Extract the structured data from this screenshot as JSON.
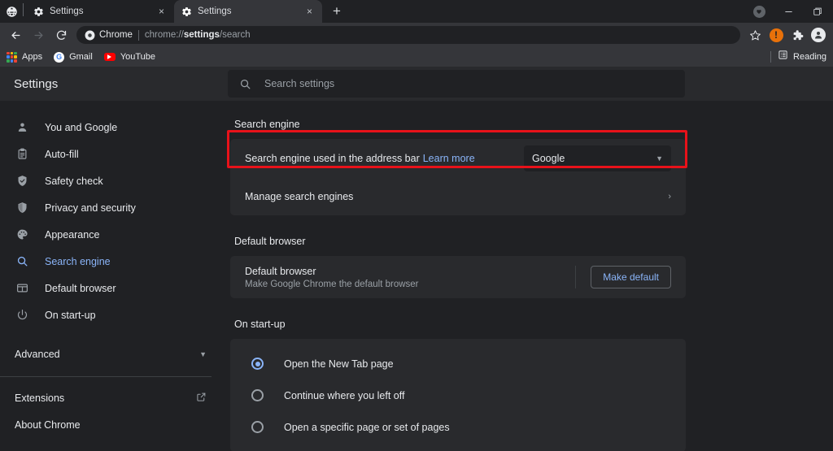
{
  "window": {
    "brand_icon": "globe-icon",
    "controls": [
      {
        "name": "window-pill-icon",
        "glyph": "♥"
      },
      {
        "name": "minimize-icon",
        "glyph": "—"
      },
      {
        "name": "maximize-icon",
        "glyph": "❐"
      }
    ]
  },
  "tabs": [
    {
      "title": "Settings",
      "favicon": "gear-icon",
      "close": "×",
      "active": false
    },
    {
      "title": "Settings",
      "favicon": "gear-icon",
      "close": "×",
      "active": true
    }
  ],
  "new_tab_label": "+",
  "toolbar": {
    "back": "←",
    "forward": "→",
    "reload": "↻",
    "omnibox": {
      "chip_label": "Chrome",
      "url_prefix": "chrome://",
      "url_bold": "settings",
      "url_suffix": "/search"
    },
    "bookmark_star": "☆",
    "alert_badge": "!",
    "extensions_icon": "puzzle-icon",
    "profile_icon": "avatar-icon"
  },
  "bookmarks": {
    "items": [
      {
        "label": "Apps",
        "icon": "apps-grid-icon"
      },
      {
        "label": "Gmail",
        "icon": "gmail-icon"
      },
      {
        "label": "YouTube",
        "icon": "youtube-icon"
      }
    ],
    "reading_list": "Reading"
  },
  "settings": {
    "title": "Settings",
    "search": {
      "placeholder": "Search settings",
      "value": ""
    },
    "sidebar": {
      "items": [
        {
          "label": "You and Google",
          "icon": "person-icon",
          "active": false
        },
        {
          "label": "Auto-fill",
          "icon": "clipboard-icon",
          "active": false
        },
        {
          "label": "Safety check",
          "icon": "shield-check-icon",
          "active": false
        },
        {
          "label": "Privacy and security",
          "icon": "shield-icon",
          "active": false
        },
        {
          "label": "Appearance",
          "icon": "palette-icon",
          "active": false
        },
        {
          "label": "Search engine",
          "icon": "search-icon",
          "active": true
        },
        {
          "label": "Default browser",
          "icon": "browser-window-icon",
          "active": false
        },
        {
          "label": "On start-up",
          "icon": "power-icon",
          "active": false
        }
      ],
      "advanced": "Advanced",
      "extensions": "Extensions",
      "about": "About Chrome"
    },
    "search_engine_section": {
      "heading": "Search engine",
      "address_bar_row": {
        "label": "Search engine used in the address bar",
        "link": "Learn more",
        "selected": "Google"
      },
      "manage_row": {
        "label": "Manage search engines",
        "chevron": "›",
        "highlighted": true
      }
    },
    "default_browser_section": {
      "heading": "Default browser",
      "primary": "Default browser",
      "secondary": "Make Google Chrome the default browser",
      "button": "Make default"
    },
    "startup_section": {
      "heading": "On start-up",
      "options": [
        {
          "label": "Open the New Tab page",
          "selected": true
        },
        {
          "label": "Continue where you left off",
          "selected": false
        },
        {
          "label": "Open a specific page or set of pages",
          "selected": false
        }
      ]
    }
  }
}
